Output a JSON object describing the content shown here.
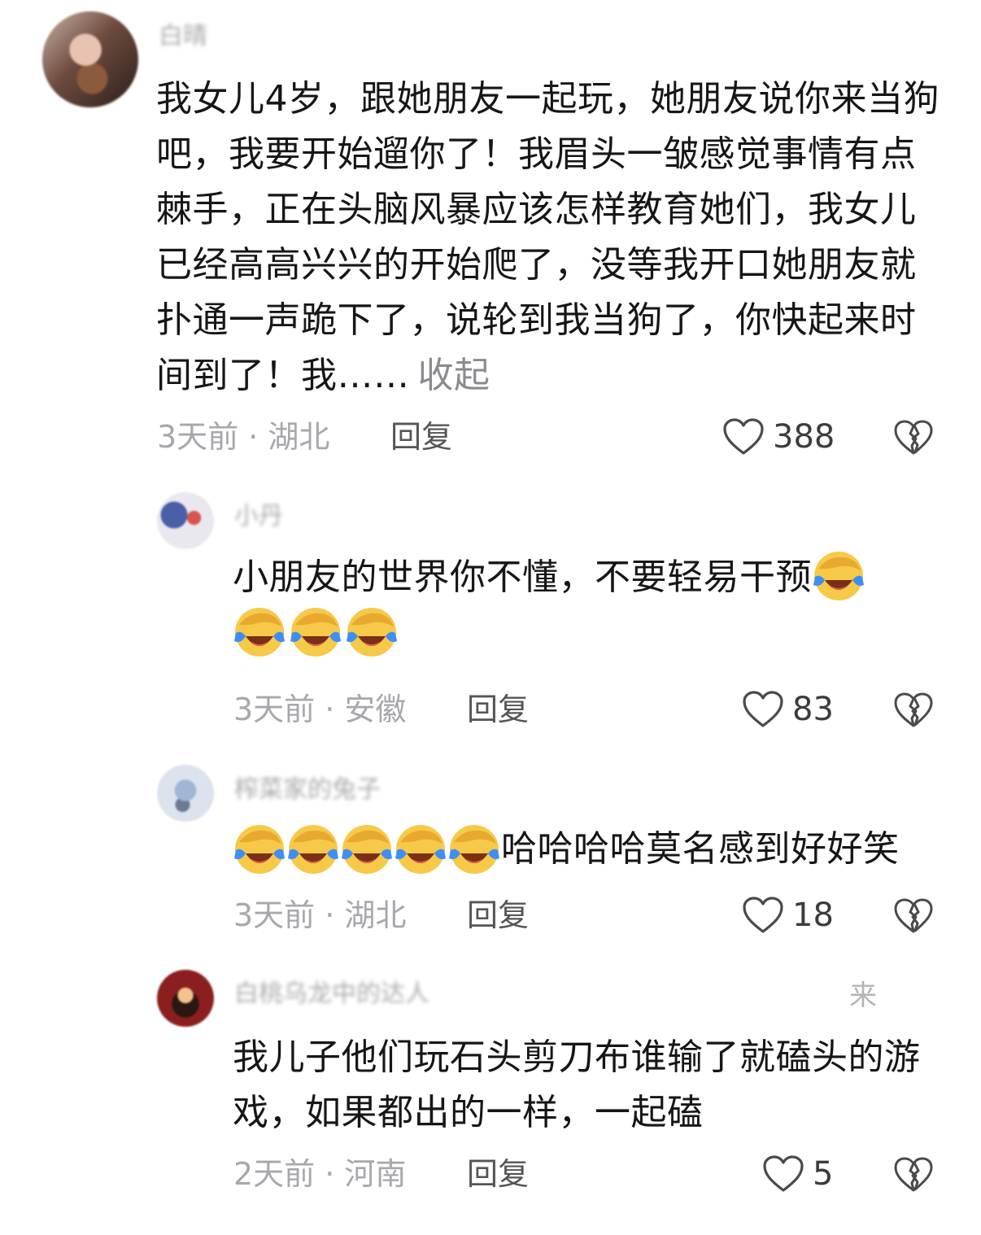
{
  "comments": [
    {
      "username": "白晴",
      "text": "我女儿4岁，跟她朋友一起玩，她朋友说你来当狗吧，我要开始遛你了！我眉头一皱感觉事情有点棘手，正在头脑风暴应该怎样教育她们，我女儿已经高高兴兴的开始爬了，没等我开口她朋友就扑通一声跪下了，说轮到我当狗了，你快起来时间到了！我……",
      "collapse_label": "收起",
      "meta": "3天前 · 湖北",
      "reply_label": "回复",
      "likes": "388"
    },
    {
      "username": "小丹",
      "text": "小朋友的世界你不懂，不要轻易干预",
      "meta": "3天前 · 安徽",
      "reply_label": "回复",
      "likes": "83",
      "emoji_count": 4
    },
    {
      "username": "榨菜家的兔子",
      "text": "哈哈哈哈莫名感到好好笑",
      "meta": "3天前 · 湖北",
      "reply_label": "回复",
      "likes": "18",
      "emoji_count": 5
    },
    {
      "username": "白桃乌龙中的达人",
      "username_tail": "来",
      "text": "我儿子他们玩石头剪刀布谁输了就磕头的游戏，如果都出的一样，一起磕",
      "meta": "2天前 · 河南",
      "reply_label": "回复",
      "likes": "5"
    }
  ],
  "icons": {
    "like": "heart-outline-icon",
    "dislike": "broken-heart-icon",
    "emoji": "laughing-crying-emoji"
  },
  "colors": {
    "background": "#ffffff",
    "text": "#161616",
    "meta": "#a7a7ad",
    "emoji_face": "#f7c948",
    "emoji_tears": "#3e8ef7"
  }
}
